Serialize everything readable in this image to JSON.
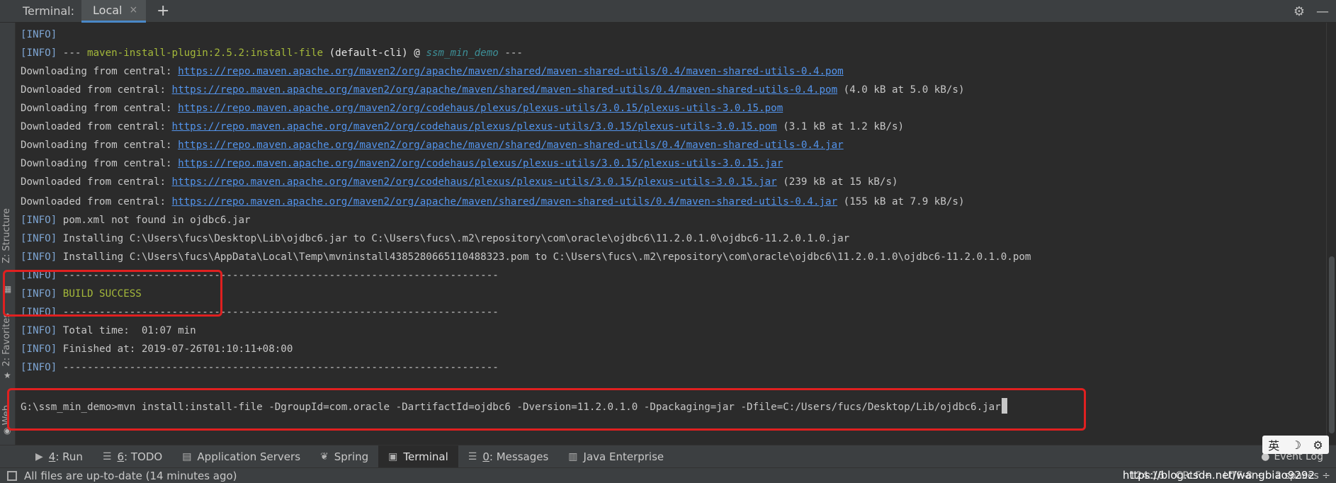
{
  "header": {
    "title": "Terminal:",
    "tab_label": "Local",
    "tab_close": "×",
    "new_tab": "+",
    "settings_glyph": "⚙",
    "minimize_glyph": "—"
  },
  "side_tabs": {
    "structure": "Z: Structure",
    "favorites": "2: Favorites",
    "web": "Web"
  },
  "terminal": {
    "info": "[INFO]",
    "l1_a": " --- ",
    "l1_plugin": "maven-install-plugin:2.5.2:install-file",
    "l1_b": " (default-cli) @ ",
    "l1_project": "ssm_min_demo",
    "l1_c": " ---",
    "downloading": "Downloading from central: ",
    "downloaded": "Downloaded from central: ",
    "url_pom_shared": "https://repo.maven.apache.org/maven2/org/apache/maven/shared/maven-shared-utils/0.4/maven-shared-utils-0.4.pom",
    "url_pom_plexus": "https://repo.maven.apache.org/maven2/org/codehaus/plexus/plexus-utils/3.0.15/plexus-utils-3.0.15.pom",
    "url_jar_shared": "https://repo.maven.apache.org/maven2/org/apache/maven/shared/maven-shared-utils/0.4/maven-shared-utils-0.4.jar",
    "url_jar_plexus": "https://repo.maven.apache.org/maven2/org/codehaus/plexus/plexus-utils/3.0.15/plexus-utils-3.0.15.jar",
    "size_1": " (4.0 kB at 5.0 kB/s)",
    "size_2": " (3.1 kB at 1.2 kB/s)",
    "size_3": " (239 kB at 15 kB/s)",
    "size_4": " (155 kB at 7.9 kB/s)",
    "pom_not_found": " pom.xml not found in ojdbc6.jar",
    "installing_1": " Installing C:\\Users\\fucs\\Desktop\\Lib\\ojdbc6.jar to C:\\Users\\fucs\\.m2\\repository\\com\\oracle\\ojdbc6\\11.2.0.1.0\\ojdbc6-11.2.0.1.0.jar",
    "installing_2": " Installing C:\\Users\\fucs\\AppData\\Local\\Temp\\mvninstall4385280665110488323.pom to C:\\Users\\fucs\\.m2\\repository\\com\\oracle\\ojdbc6\\11.2.0.1.0\\ojdbc6-11.2.0.1.0.pom",
    "separator": " ------------------------------------------------------------------------",
    "build_success": "BUILD SUCCESS",
    "total_time": " Total time:  01:07 min",
    "finished_at": " Finished at: 2019-07-26T01:10:11+08:00",
    "prompt": "G:\\ssm_min_demo>",
    "command": "mvn install:install-file -DgroupId=com.oracle -DartifactId=ojdbc6 -Dversion=11.2.0.1.0 -Dpackaging=jar -Dfile=C:/Users/fucs/Desktop/Lib/ojdbc6.jar"
  },
  "toolbar": {
    "run_num": "4",
    "run_label": ": Run",
    "todo_num": "6",
    "todo_label": ": TODO",
    "app_servers": "Application Servers",
    "spring": "Spring",
    "terminal": "Terminal",
    "messages_num": "0",
    "messages_label": ": Messages",
    "java_enterprise": "Java Enterprise",
    "event_log": "Event Log",
    "ime_1": "英",
    "ime_2": "☽",
    "ime_3": "⚙"
  },
  "status": {
    "message": "All files are up-to-date (14 minutes ago)",
    "position": "124:16",
    "line_sep": "CRLF ÷",
    "encoding": "UTF-8 ÷",
    "indent": "2 spaces ÷",
    "watermark": "https://blog.csdn.net/wangbiao9292"
  },
  "colors": {
    "background": "#2b2b2b",
    "info": "#7ea6d4",
    "plugin": "#a4b83a",
    "link": "#5394ec",
    "highlight": "#e02020"
  }
}
